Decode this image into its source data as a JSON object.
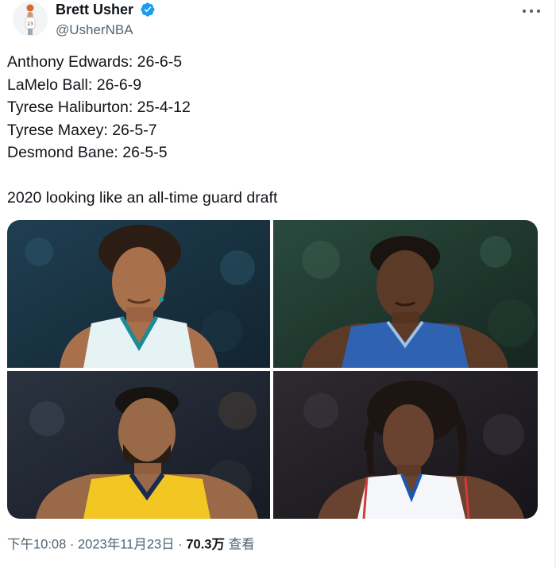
{
  "author": {
    "display_name": "Brett Usher",
    "handle": "@UsherNBA"
  },
  "tweet": {
    "lines": [
      "Anthony Edwards: 26-6-5",
      "LaMelo Ball: 26-6-9",
      "Tyrese Haliburton: 25-4-12",
      "Tyrese Maxey: 26-5-7",
      "Desmond Bane: 26-5-5",
      "",
      "2020 looking like an all-time guard draft"
    ]
  },
  "media": {
    "photos": [
      {
        "jersey_color": "#e6f3f4",
        "trim_color": "#1d8a9a"
      },
      {
        "jersey_color": "#2f62b0",
        "trim_color": "#9ec0e6"
      },
      {
        "jersey_color": "#f2c623",
        "trim_color": "#1b2a55"
      },
      {
        "jersey_color": "#f4f6fa",
        "trim_color": "#1a56b8"
      }
    ]
  },
  "footer": {
    "time": "下午10:08",
    "separator": "·",
    "date": "2023年11月23日",
    "views_count": "70.3万",
    "views_label": "查看"
  },
  "colors": {
    "verified_blue": "#1d9bf0",
    "secondary_text": "#536471"
  },
  "icons": [
    "verified-badge-icon",
    "more-options-icon"
  ]
}
